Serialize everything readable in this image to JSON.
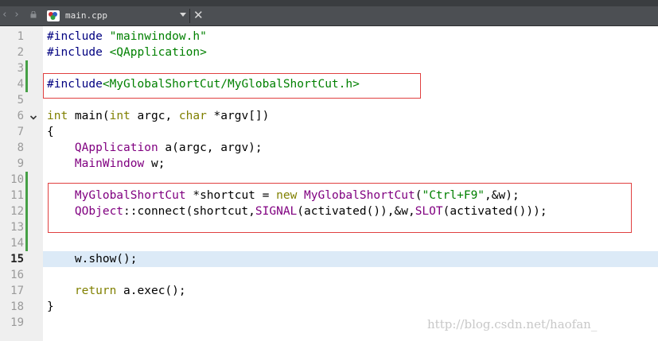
{
  "tab": {
    "file_name": "main.cpp",
    "file_icon": "qt-cpp-file-icon"
  },
  "gutter": {
    "line_numbers": [
      "1",
      "2",
      "3",
      "4",
      "5",
      "6",
      "7",
      "8",
      "9",
      "10",
      "11",
      "12",
      "13",
      "14",
      "15",
      "16",
      "17",
      "18",
      "19"
    ],
    "current_line": "15"
  },
  "code": {
    "l1": {
      "a": "#include ",
      "b": "\"mainwindow.h\""
    },
    "l2": {
      "a": "#include ",
      "b": "<QApplication>"
    },
    "l4": {
      "a": "#include",
      "b": "<MyGlobalShortCut/MyGlobalShortCut.h>"
    },
    "l6": {
      "a": "int",
      "b": " main(",
      "c": "int",
      "d": " argc, ",
      "e": "char",
      "f": " *argv[])"
    },
    "l7": {
      "a": "{"
    },
    "l8": {
      "a": "    ",
      "b": "QApplication",
      "c": " a(argc, argv);"
    },
    "l9": {
      "a": "    ",
      "b": "MainWindow",
      "c": " w;"
    },
    "l11": {
      "a": "    ",
      "b": "MyGlobalShortCut",
      "c": " *shortcut = ",
      "d": "new",
      "e": " ",
      "f": "MyGlobalShortCut",
      "g": "(",
      "h": "\"Ctrl+F9\"",
      "i": ",&w);"
    },
    "l12": {
      "a": "    ",
      "b": "QObject",
      "c": "::connect(shortcut,",
      "d": "SIGNAL",
      "e": "(activated()),&w,",
      "f": "SLOT",
      "g": "(activated()));"
    },
    "l15": {
      "a": "    w.show();"
    },
    "l17": {
      "a": "    ",
      "b": "return",
      "c": " a.exec();"
    },
    "l18": {
      "a": "}"
    }
  },
  "watermark": "http://blog.csdn.net/haofan_",
  "colors": {
    "preprocessor": "#000080",
    "string": "#008000",
    "keyword": "#808000",
    "type": "#800080",
    "current_line": "#dceaf7",
    "highlight_box": "#e04040"
  }
}
